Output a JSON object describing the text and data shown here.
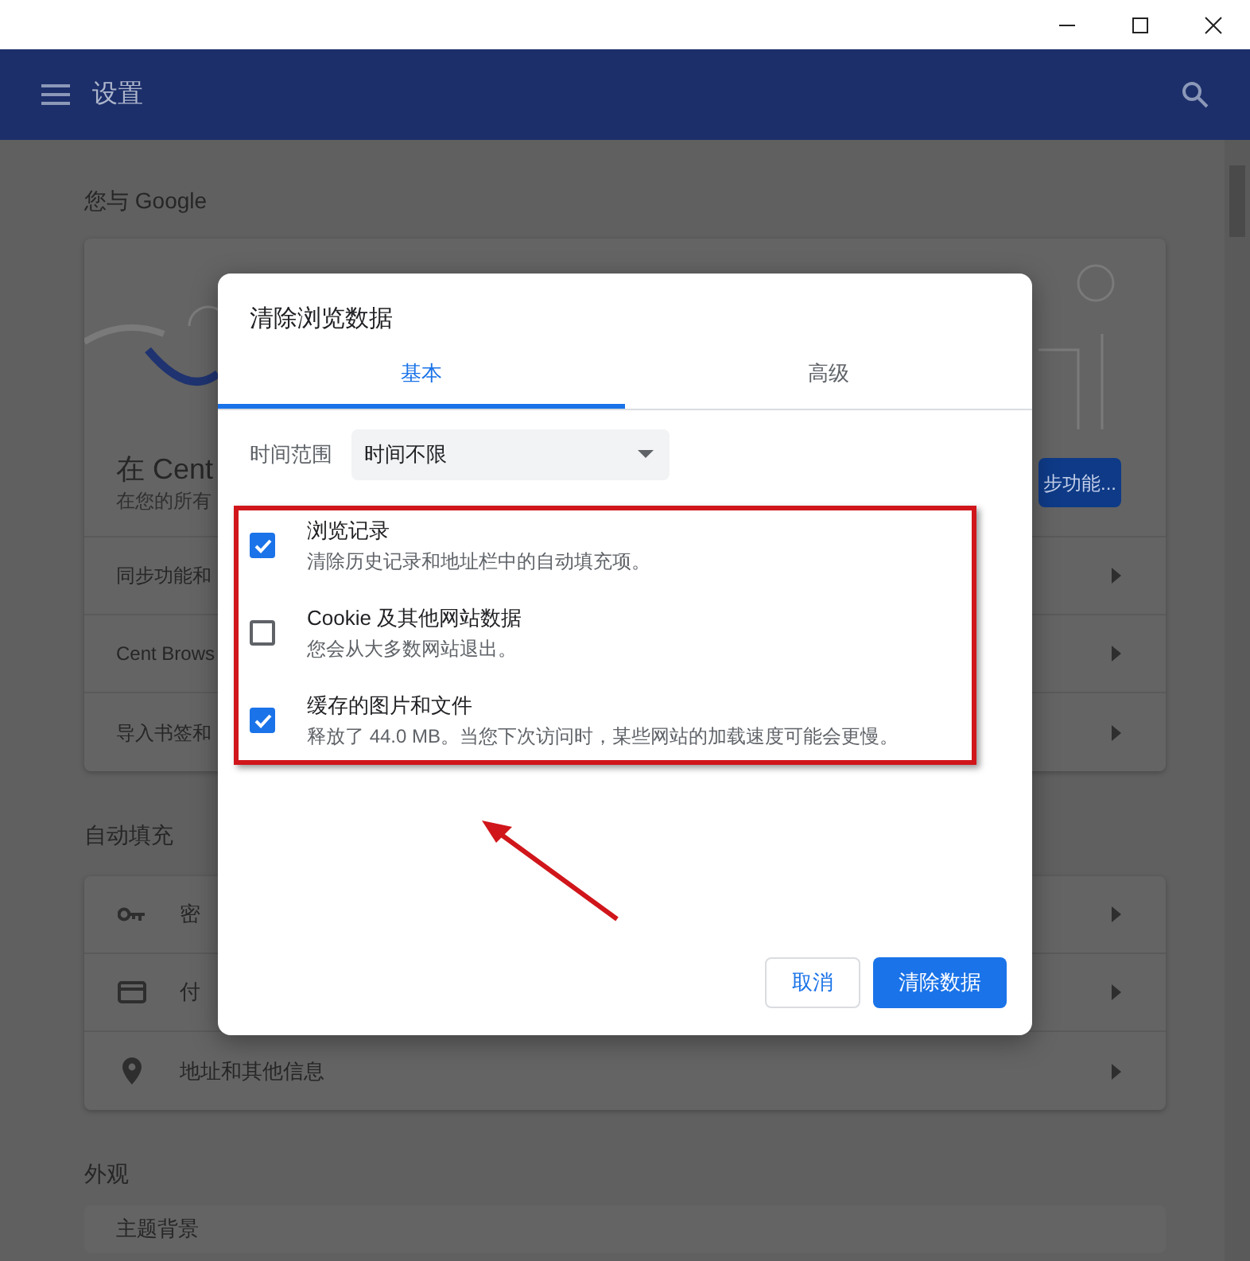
{
  "header": {
    "title": "设置"
  },
  "you_and_google": {
    "heading": "您与 Google",
    "profile": {
      "title": "在 Cent",
      "subtitle": "在您的所有",
      "button": "步功能..."
    },
    "rows": [
      "同步功能和",
      "Cent Brows",
      "导入书签和"
    ]
  },
  "autofill": {
    "heading": "自动填充",
    "rows": [
      {
        "label": "密",
        "kind": "key"
      },
      {
        "label": "付",
        "kind": "card"
      },
      {
        "label": "地址和其他信息",
        "kind": "pin"
      }
    ]
  },
  "appearance": {
    "heading": "外观",
    "rows": [
      "主题背景"
    ]
  },
  "dialog": {
    "title": "清除浏览数据",
    "tabs": [
      {
        "label": "基本",
        "selected": true
      },
      {
        "label": "高级",
        "selected": false
      }
    ],
    "time_range": {
      "label": "时间范围",
      "value": "时间不限"
    },
    "options": [
      {
        "title": "浏览记录",
        "description": "清除历史记录和地址栏中的自动填充项。",
        "checked": true
      },
      {
        "title": "Cookie 及其他网站数据",
        "description": "您会从大多数网站退出。",
        "checked": false
      },
      {
        "title": "缓存的图片和文件",
        "description": "释放了 44.0 MB。当您下次访问时，某些网站的加载速度可能会更慢。",
        "checked": true
      }
    ],
    "buttons": [
      {
        "label": "取消",
        "kind": "secondary"
      },
      {
        "label": "清除数据",
        "kind": "primary"
      }
    ]
  }
}
